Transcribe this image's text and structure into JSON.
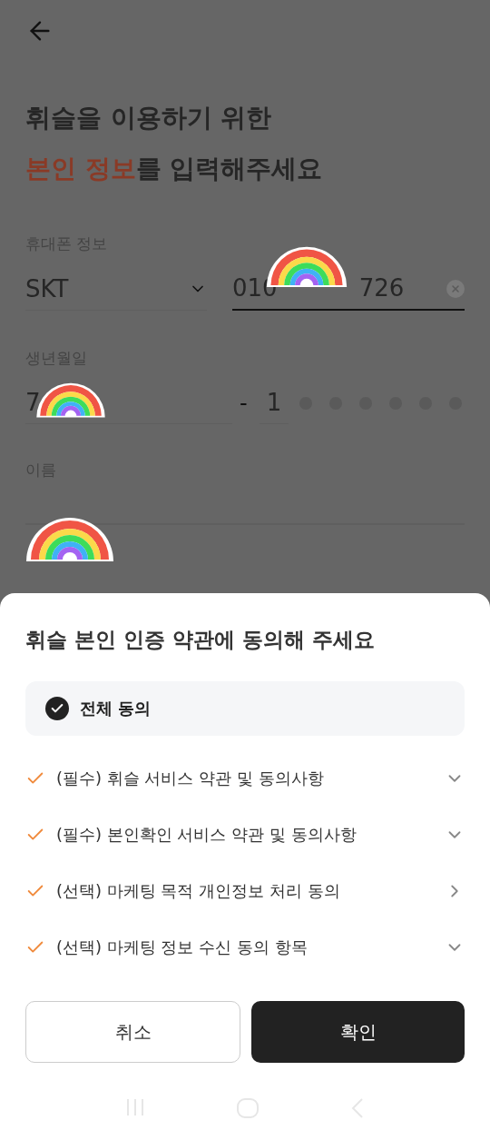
{
  "header": {
    "title_line1": "휘슬을 이용하기 위한",
    "title_highlight": "본인 정보",
    "title_rest": "를 입력해주세요"
  },
  "phone": {
    "label": "휴대폰 정보",
    "carrier": "SKT",
    "number_start": "010",
    "number_end": "726"
  },
  "birth": {
    "label": "생년월일",
    "date_start": "7",
    "separator": "-",
    "gender_digit": "1"
  },
  "name": {
    "label": "이름"
  },
  "sheet": {
    "title": "휘슬 본인 인증 약관에 동의해 주세요",
    "all_agree": {
      "label": "전체 동의",
      "checked": true
    },
    "terms": [
      {
        "label": "(필수) 휘슬 서비스 약관 및 동의사항",
        "checked": true,
        "kind": "expand"
      },
      {
        "label": "(필수) 본인확인 서비스 약관 및 동의사항",
        "checked": true,
        "kind": "expand"
      },
      {
        "label": "(선택) 마케팅 목적 개인정보 처리 동의",
        "checked": true,
        "kind": "link"
      },
      {
        "label": "(선택) 마케팅 정보 수신 동의 항목",
        "checked": true,
        "kind": "expand"
      }
    ],
    "buttons": [
      {
        "label": "취소",
        "kind": "secondary"
      },
      {
        "label": "확인",
        "kind": "primary"
      }
    ]
  }
}
